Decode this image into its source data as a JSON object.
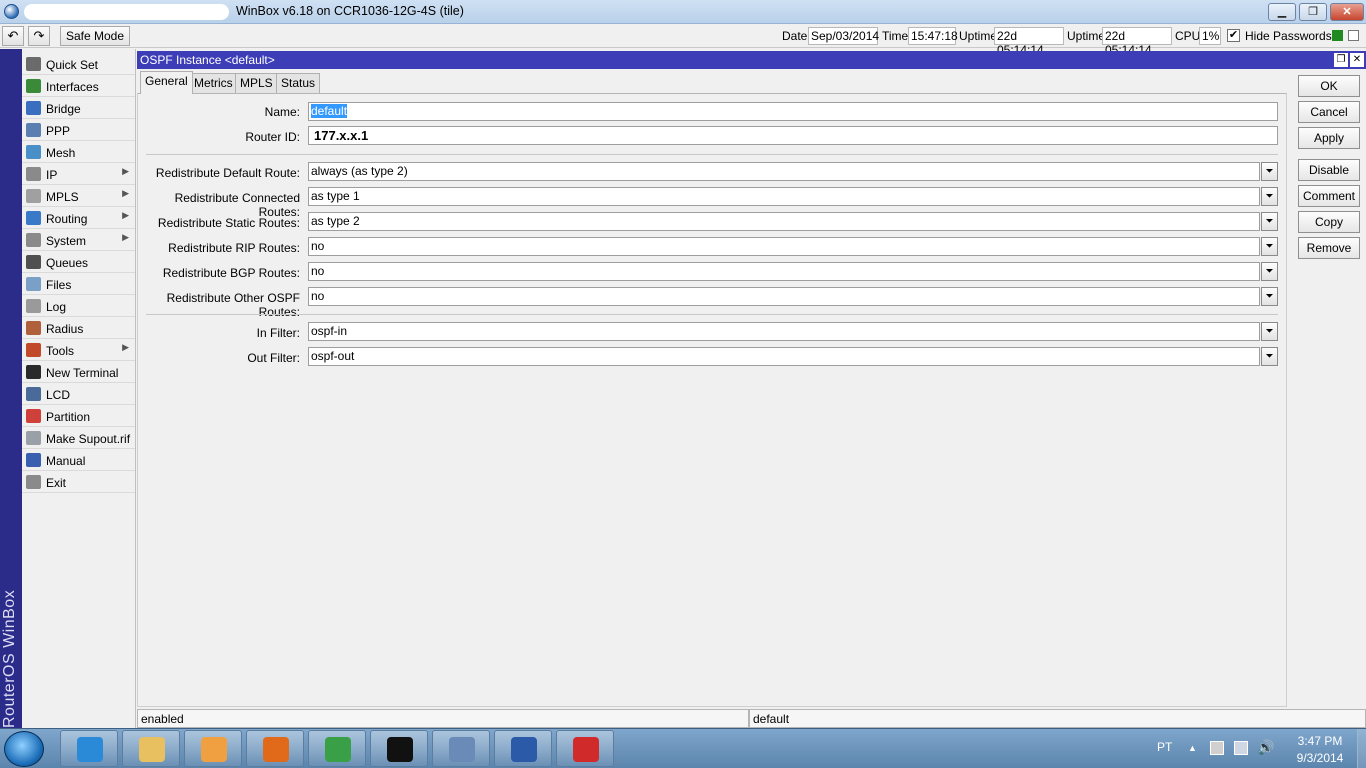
{
  "window": {
    "title": "WinBox v6.18 on CCR1036-12G-4S (tile)",
    "controls": {
      "minimize": "▁",
      "restore": "❐",
      "close": "✕"
    }
  },
  "toolbar": {
    "undo_icon": "↶",
    "redo_icon": "↷",
    "safe_mode": "Safe Mode",
    "date_label": "Date:",
    "date_value": "Sep/03/2014",
    "time_label": "Time:",
    "time_value": "15:47:18",
    "uptime1_label": "Uptime:",
    "uptime1_value": "22d 05:14:14",
    "uptime2_label": "Uptime:",
    "uptime2_value": "22d 05:14:14",
    "cpu_label": "CPU:",
    "cpu_value": "1%",
    "hide_passwords": "Hide Passwords",
    "hide_passwords_checked": "✔"
  },
  "vertical_brand": "RouterOS WinBox",
  "sidebar": {
    "items": [
      {
        "label": "Quick Set",
        "icon": "quick-set-icon",
        "color": "#6b6b6b",
        "submenu": false
      },
      {
        "label": "Interfaces",
        "icon": "interfaces-icon",
        "color": "#3a8a3a",
        "submenu": false
      },
      {
        "label": "Bridge",
        "icon": "bridge-icon",
        "color": "#3a6fc0",
        "submenu": false
      },
      {
        "label": "PPP",
        "icon": "ppp-icon",
        "color": "#5a7fb0",
        "submenu": false
      },
      {
        "label": "Mesh",
        "icon": "mesh-icon",
        "color": "#4a90c8",
        "submenu": false
      },
      {
        "label": "IP",
        "icon": "ip-icon",
        "color": "#8a8a8a",
        "submenu": true
      },
      {
        "label": "MPLS",
        "icon": "mpls-icon",
        "color": "#a0a0a0",
        "submenu": true
      },
      {
        "label": "Routing",
        "icon": "routing-icon",
        "color": "#3a78c8",
        "submenu": true
      },
      {
        "label": "System",
        "icon": "system-gear-icon",
        "color": "#8a8a8a",
        "submenu": true
      },
      {
        "label": "Queues",
        "icon": "queues-icon",
        "color": "#505050",
        "submenu": false
      },
      {
        "label": "Files",
        "icon": "files-folder-icon",
        "color": "#7aa0c8",
        "submenu": false
      },
      {
        "label": "Log",
        "icon": "log-icon",
        "color": "#9a9a9a",
        "submenu": false
      },
      {
        "label": "Radius",
        "icon": "radius-icon",
        "color": "#b0603a",
        "submenu": false
      },
      {
        "label": "Tools",
        "icon": "tools-icon",
        "color": "#c04a2a",
        "submenu": true
      },
      {
        "label": "New Terminal",
        "icon": "terminal-icon",
        "color": "#2a2a2a",
        "submenu": false
      },
      {
        "label": "LCD",
        "icon": "lcd-icon",
        "color": "#4a6a9a",
        "submenu": false
      },
      {
        "label": "Partition",
        "icon": "partition-icon",
        "color": "#d0403a",
        "submenu": false
      },
      {
        "label": "Make Supout.rif",
        "icon": "supout-file-icon",
        "color": "#9aa0a8",
        "submenu": false
      },
      {
        "label": "Manual",
        "icon": "manual-help-icon",
        "color": "#3a5fb0",
        "submenu": false
      },
      {
        "label": "Exit",
        "icon": "exit-icon",
        "color": "#8a8a8a",
        "submenu": false
      }
    ]
  },
  "ospf_window": {
    "title": "OSPF Instance <default>",
    "tabs": [
      "General",
      "Metrics",
      "MPLS",
      "Status"
    ],
    "fields": {
      "name_label": "Name:",
      "name_value": "default",
      "router_id_label": "Router ID:",
      "router_id_value": "177.x.x.1",
      "redist_default_label": "Redistribute Default Route:",
      "redist_default_value": "always (as type 2)",
      "redist_connected_label": "Redistribute Connected Routes:",
      "redist_connected_value": "as type 1",
      "redist_static_label": "Redistribute Static Routes:",
      "redist_static_value": "as type 2",
      "redist_rip_label": "Redistribute RIP Routes:",
      "redist_rip_value": "no",
      "redist_bgp_label": "Redistribute BGP Routes:",
      "redist_bgp_value": "no",
      "redist_other_label": "Redistribute Other OSPF Routes:",
      "redist_other_value": "no",
      "in_filter_label": "In Filter:",
      "in_filter_value": "ospf-in",
      "out_filter_label": "Out Filter:",
      "out_filter_value": "ospf-out"
    },
    "buttons": {
      "ok": "OK",
      "cancel": "Cancel",
      "apply": "Apply",
      "disable": "Disable",
      "comment": "Comment",
      "copy": "Copy",
      "remove": "Remove"
    },
    "status_left": "enabled",
    "status_right": "default",
    "dropdown_glyph": "⏷"
  },
  "taskbar": {
    "apps": [
      {
        "name": "internet-explorer-icon",
        "color": "#2a8ad8"
      },
      {
        "name": "file-explorer-icon",
        "color": "#e8c060"
      },
      {
        "name": "media-player-icon",
        "color": "#f0a040"
      },
      {
        "name": "firefox-icon",
        "color": "#e06a1a"
      },
      {
        "name": "chrome-icon",
        "color": "#3aa048"
      },
      {
        "name": "command-prompt-icon",
        "color": "#111111"
      },
      {
        "name": "winbox-icon",
        "color": "#6a8ab8"
      },
      {
        "name": "word-icon",
        "color": "#2a5aa8"
      },
      {
        "name": "app-red-icon",
        "color": "#d02a2a"
      }
    ],
    "language": "PT",
    "clock_time": "3:47 PM",
    "clock_date": "9/3/2014"
  }
}
